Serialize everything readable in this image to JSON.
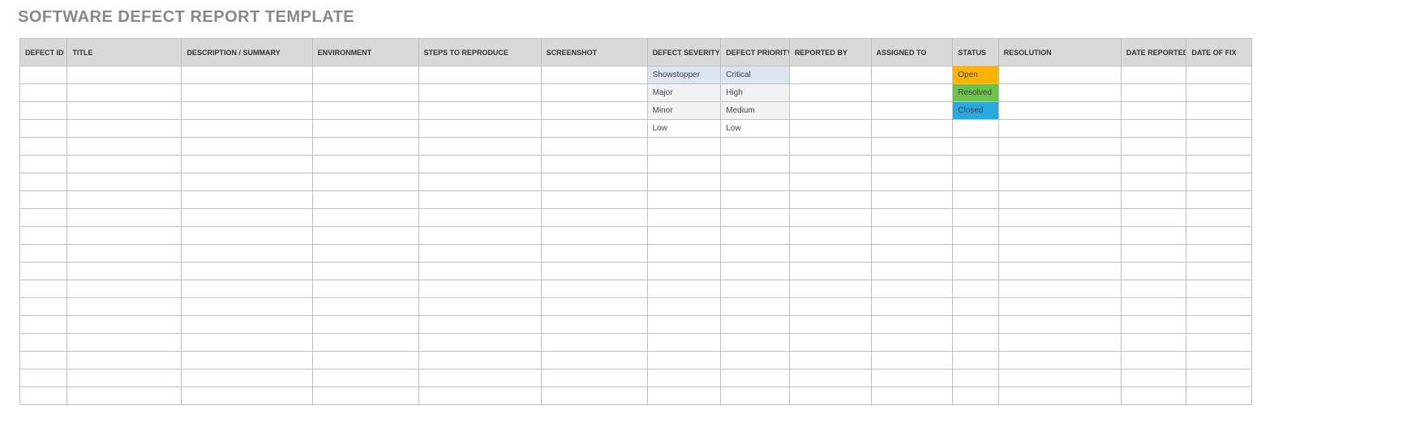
{
  "page_title": "SOFTWARE DEFECT REPORT TEMPLATE",
  "columns": [
    "DEFECT ID",
    "TITLE",
    "DESCRIPTION / SUMMARY",
    "ENVIRONMENT",
    "STEPS TO REPRODUCE",
    "SCREENSHOT",
    "DEFECT SEVERITY",
    "DEFECT PRIORITY",
    "REPORTED BY",
    "ASSIGNED TO",
    "STATUS",
    "RESOLUTION",
    "DATE REPORTED",
    "DATE OF FIX"
  ],
  "rows": [
    {
      "severity": "Showstopper",
      "severity_bg": "bg-lightblue",
      "priority": "Critical",
      "priority_bg": "bg-lightblue",
      "status": "Open",
      "status_bg": "bg-orange"
    },
    {
      "severity": "Major",
      "severity_bg": "bg-palegray",
      "priority": "High",
      "priority_bg": "bg-palegray",
      "status": "Resolved",
      "status_bg": "bg-green"
    },
    {
      "severity": "Minor",
      "severity_bg": "bg-palegray",
      "priority": "Medium",
      "priority_bg": "bg-palegray",
      "status": "Closed",
      "status_bg": "bg-blue"
    },
    {
      "severity": "Low",
      "severity_bg": "",
      "priority": "Low",
      "priority_bg": "",
      "status": "",
      "status_bg": ""
    },
    {},
    {},
    {},
    {},
    {},
    {},
    {},
    {},
    {},
    {},
    {},
    {},
    {},
    {},
    {}
  ]
}
